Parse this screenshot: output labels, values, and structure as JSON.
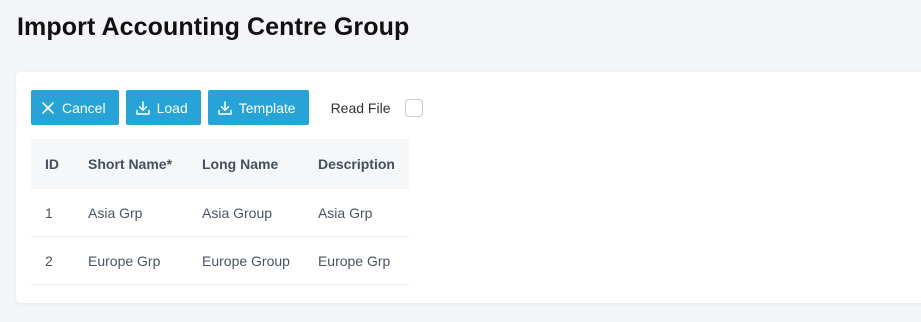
{
  "page": {
    "title": "Import Accounting Centre Group"
  },
  "toolbar": {
    "cancel_label": "Cancel",
    "cancel_icon": "close-icon",
    "load_label": "Load",
    "load_icon": "download-icon",
    "template_label": "Template",
    "template_icon": "download-icon",
    "read_file_label": "Read File",
    "read_file_checked": false,
    "button_color": "#27a3d8"
  },
  "table": {
    "headers": [
      "ID",
      "Short Name*",
      "Long Name",
      "Description"
    ],
    "rows": [
      {
        "id": "1",
        "short_name": "Asia Grp",
        "long_name": "Asia Group",
        "description": "Asia Grp"
      },
      {
        "id": "2",
        "short_name": "Europe Grp",
        "long_name": "Europe Group",
        "description": "Europe Grp"
      }
    ]
  }
}
